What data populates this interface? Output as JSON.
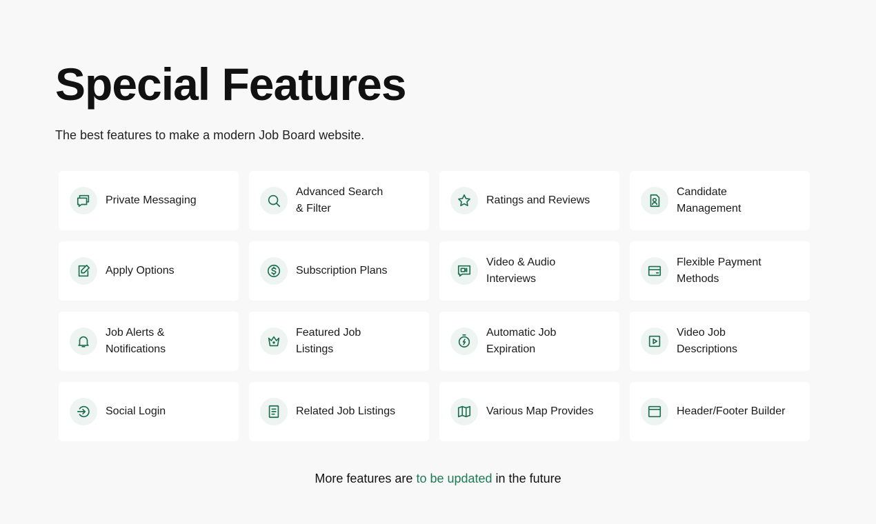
{
  "header": {
    "title": "Special Features",
    "subtitle": "The best features to make a modern Job Board website."
  },
  "features": [
    {
      "label": "Private Messaging",
      "icon": "messages-icon"
    },
    {
      "label": "Advanced Search\n& Filter",
      "icon": "search-icon"
    },
    {
      "label": "Ratings and Reviews",
      "icon": "star-icon"
    },
    {
      "label": "Candidate\nManagement",
      "icon": "candidate-file-icon"
    },
    {
      "label": "Apply Options",
      "icon": "edit-document-icon"
    },
    {
      "label": "Subscription Plans",
      "icon": "dollar-circle-icon"
    },
    {
      "label": "Video & Audio\nInterviews",
      "icon": "video-chat-icon"
    },
    {
      "label": "Flexible Payment\nMethods",
      "icon": "wallet-icon"
    },
    {
      "label": "Job Alerts &\nNotifications",
      "icon": "bell-icon"
    },
    {
      "label": "Featured Job\nListings",
      "icon": "crown-icon"
    },
    {
      "label": "Automatic Job\nExpiration",
      "icon": "timer-icon"
    },
    {
      "label": "Video Job\nDescriptions",
      "icon": "play-square-icon"
    },
    {
      "label": "Social Login",
      "icon": "login-icon"
    },
    {
      "label": "Related Job Listings",
      "icon": "list-document-icon"
    },
    {
      "label": "Various Map Provides",
      "icon": "map-icon"
    },
    {
      "label": "Header/Footer Builder",
      "icon": "layout-icon"
    }
  ],
  "footer": {
    "prefix": "More features are ",
    "link": "to be updated",
    "suffix": " in the future"
  },
  "colors": {
    "accent": "#1b6e4f",
    "icon_bg": "#eef4f1",
    "page_bg": "#f8f8f8",
    "card_bg": "#ffffff"
  }
}
